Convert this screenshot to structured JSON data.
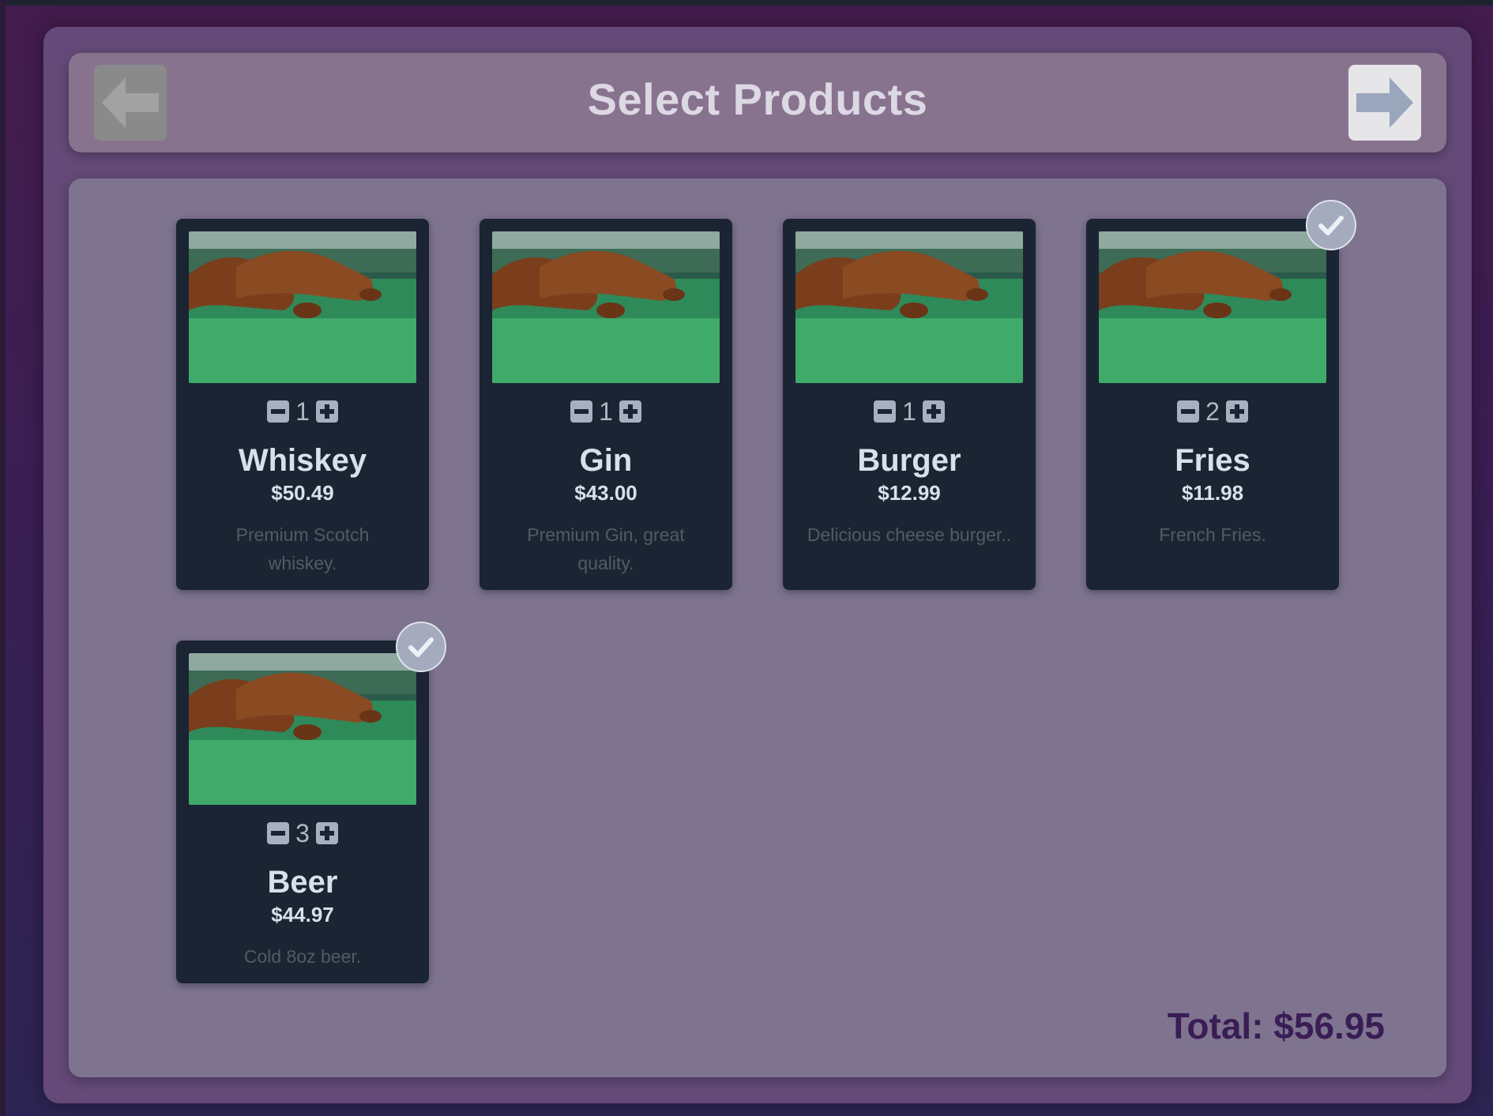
{
  "header": {
    "title": "Select Products",
    "back_icon": "arrow-left-icon",
    "next_icon": "arrow-right-icon"
  },
  "products": [
    {
      "name": "Whiskey",
      "price": "$50.49",
      "description": "Premium Scotch whiskey.",
      "quantity": "1",
      "selected": false
    },
    {
      "name": "Gin",
      "price": "$43.00",
      "description": "Premium Gin, great quality.",
      "quantity": "1",
      "selected": false
    },
    {
      "name": "Burger",
      "price": "$12.99",
      "description": "Delicious cheese burger..",
      "quantity": "1",
      "selected": false
    },
    {
      "name": "Fries",
      "price": "$11.98",
      "description": "French Fries.",
      "quantity": "2",
      "selected": true
    },
    {
      "name": "Beer",
      "price": "$44.97",
      "description": "Cold 8oz beer.",
      "quantity": "3",
      "selected": true
    }
  ],
  "total": "Total: $56.95",
  "colors": {
    "background": "#3a1e53",
    "panel": "#7e7490",
    "card": "#1b2433",
    "badge": "#a3abbd",
    "total_text": "#3a1d55"
  }
}
